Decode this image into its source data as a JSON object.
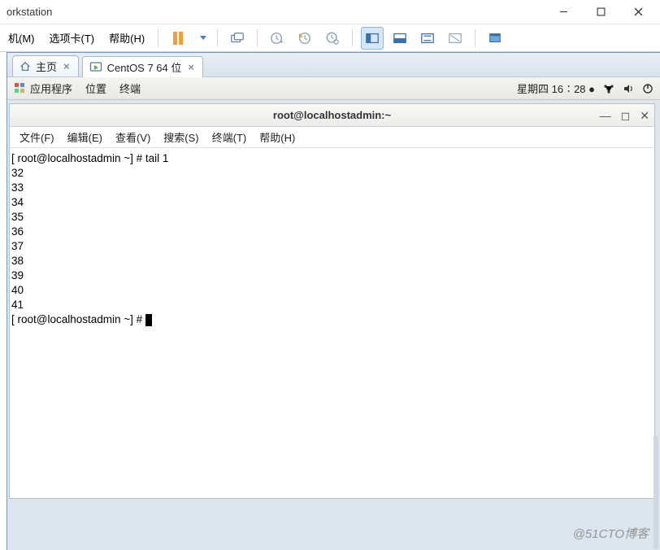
{
  "outer": {
    "title_fragment": "orkstation",
    "menus": {
      "machine": "机(M)",
      "tabs": "选项卡(T)",
      "help": "帮助(H)"
    }
  },
  "tabs": {
    "home_label": "主页",
    "active_label": "CentOS 7 64 位"
  },
  "guest": {
    "apps_label": "应用程序",
    "places_label": "位置",
    "terminal_label": "终端",
    "clock": "星期四 16∶28 ●"
  },
  "terminal": {
    "title": "root@localhostadmin:~",
    "menus": {
      "file": "文件(F)",
      "edit": "编辑(E)",
      "view": "查看(V)",
      "search": "搜索(S)",
      "terminal": "终端(T)",
      "help": "帮助(H)"
    },
    "line_prompt1": "[ root@localhostadmin ~] # tail 1",
    "out": [
      "32",
      "33",
      "34",
      "35",
      "36",
      "37",
      "38",
      "39",
      "40",
      "41"
    ],
    "line_prompt2": "[ root@localhostadmin ~] # "
  },
  "watermark": "@51CTO博客",
  "icons": {
    "minimize": "minimize-icon",
    "maximize": "maximize-icon",
    "close": "close-icon",
    "pause": "pause-icon",
    "dropdown": "chevron-down-icon",
    "send_keys": "send-keys-icon",
    "snapshot1": "clock-play-icon",
    "snapshot2": "clock-back-icon",
    "snapshot3": "clock-gear-icon",
    "view_split": "view-split-icon",
    "view_single1": "view-single-icon",
    "view_fit": "view-fit-icon",
    "view_span": "view-span-icon",
    "view_full": "view-fullscreen-icon",
    "home": "home-icon",
    "vm_play": "vm-running-icon",
    "app_launcher": "app-launcher-icon",
    "network": "network-icon",
    "volume": "volume-icon",
    "power": "power-icon"
  }
}
